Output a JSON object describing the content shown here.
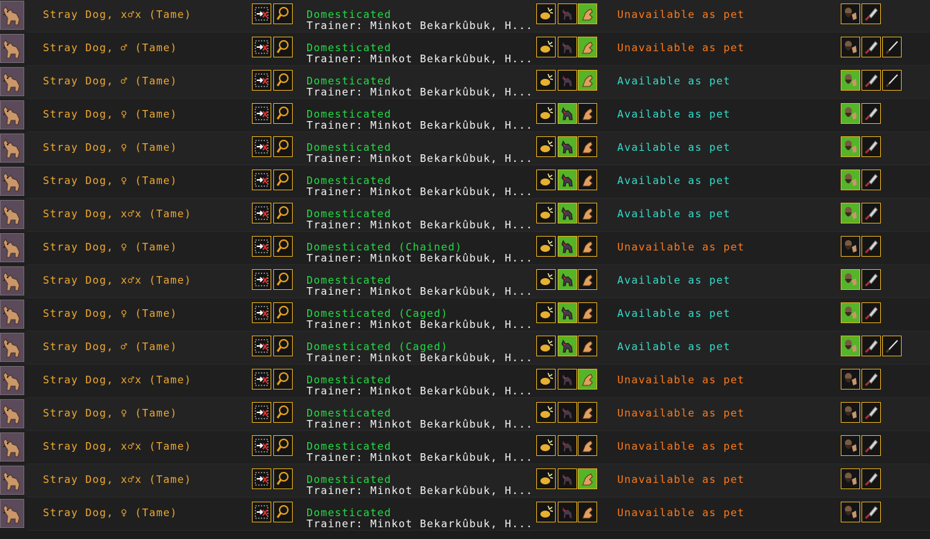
{
  "colors": {
    "name": "#f0a830",
    "domesticated": "#22dd44",
    "trainer": "#f4f4f4",
    "unavailable": "#ff7a1a",
    "available": "#33ddcc",
    "button_border": "#e8b020",
    "button_active": "#55b428"
  },
  "icons": {
    "portrait": "stray-dog-portrait",
    "assign": "assign-arrow-icon",
    "inspect": "magnifier-icon",
    "train_1": "war-training-icon",
    "train_2": "hunting-training-icon",
    "train_3": "pet-training-icon",
    "adopt": "dwarf-adopt-icon",
    "butcher": "butcher-cleaver-icon",
    "geld": "geld-knife-icon"
  },
  "rows": [
    {
      "name": "Stray Dog, x♂x (Tame)",
      "status": "Domesticated",
      "trainer": "Trainer: Minkot Bekarkûbuk, H...",
      "pet": "Unavailable as pet",
      "available": false,
      "training": [
        false,
        false,
        true
      ],
      "adopt_on": false,
      "geld": false
    },
    {
      "name": "Stray Dog, ♂ (Tame)",
      "status": "Domesticated",
      "trainer": "Trainer: Minkot Bekarkûbuk, H...",
      "pet": "Unavailable as pet",
      "available": false,
      "training": [
        false,
        false,
        true
      ],
      "adopt_on": false,
      "geld": true
    },
    {
      "name": "Stray Dog, ♂ (Tame)",
      "status": "Domesticated",
      "trainer": "Trainer: Minkot Bekarkûbuk, H...",
      "pet": "Available as pet",
      "available": true,
      "training": [
        false,
        false,
        true
      ],
      "adopt_on": true,
      "geld": true
    },
    {
      "name": "Stray Dog, ♀ (Tame)",
      "status": "Domesticated",
      "trainer": "Trainer: Minkot Bekarkûbuk, H...",
      "pet": "Available as pet",
      "available": true,
      "training": [
        false,
        true,
        false
      ],
      "adopt_on": true,
      "geld": false
    },
    {
      "name": "Stray Dog, ♀ (Tame)",
      "status": "Domesticated",
      "trainer": "Trainer: Minkot Bekarkûbuk, H...",
      "pet": "Available as pet",
      "available": true,
      "training": [
        false,
        true,
        false
      ],
      "adopt_on": true,
      "geld": false
    },
    {
      "name": "Stray Dog, ♀ (Tame)",
      "status": "Domesticated",
      "trainer": "Trainer: Minkot Bekarkûbuk, H...",
      "pet": "Available as pet",
      "available": true,
      "training": [
        false,
        true,
        false
      ],
      "adopt_on": true,
      "geld": false
    },
    {
      "name": "Stray Dog, x♂x (Tame)",
      "status": "Domesticated",
      "trainer": "Trainer: Minkot Bekarkûbuk, H...",
      "pet": "Available as pet",
      "available": true,
      "training": [
        false,
        true,
        false
      ],
      "adopt_on": true,
      "geld": false
    },
    {
      "name": "Stray Dog, ♀ (Tame)",
      "status": "Domesticated (Chained)",
      "trainer": "Trainer: Minkot Bekarkûbuk, H...",
      "pet": "Unavailable as pet",
      "available": false,
      "training": [
        false,
        true,
        false
      ],
      "adopt_on": false,
      "geld": false
    },
    {
      "name": "Stray Dog, x♂x (Tame)",
      "status": "Domesticated",
      "trainer": "Trainer: Minkot Bekarkûbuk, H...",
      "pet": "Available as pet",
      "available": true,
      "training": [
        false,
        true,
        false
      ],
      "adopt_on": true,
      "geld": false
    },
    {
      "name": "Stray Dog, ♀ (Tame)",
      "status": "Domesticated (Caged)",
      "trainer": "Trainer: Minkot Bekarkûbuk, H...",
      "pet": "Available as pet",
      "available": true,
      "training": [
        false,
        true,
        false
      ],
      "adopt_on": true,
      "geld": false
    },
    {
      "name": "Stray Dog, ♂ (Tame)",
      "status": "Domesticated (Caged)",
      "trainer": "Trainer: Minkot Bekarkûbuk, H...",
      "pet": "Available as pet",
      "available": true,
      "training": [
        false,
        true,
        false
      ],
      "adopt_on": true,
      "geld": true
    },
    {
      "name": "Stray Dog, x♂x (Tame)",
      "status": "Domesticated",
      "trainer": "Trainer: Minkot Bekarkûbuk, H...",
      "pet": "Unavailable as pet",
      "available": false,
      "training": [
        false,
        false,
        true
      ],
      "adopt_on": false,
      "geld": false
    },
    {
      "name": "Stray Dog, ♀ (Tame)",
      "status": "Domesticated",
      "trainer": "Trainer: Minkot Bekarkûbuk, H...",
      "pet": "Unavailable as pet",
      "available": false,
      "training": [
        false,
        false,
        false
      ],
      "adopt_on": false,
      "geld": false
    },
    {
      "name": "Stray Dog, x♂x (Tame)",
      "status": "Domesticated",
      "trainer": "Trainer: Minkot Bekarkûbuk, H...",
      "pet": "Unavailable as pet",
      "available": false,
      "training": [
        false,
        false,
        false
      ],
      "adopt_on": false,
      "geld": false
    },
    {
      "name": "Stray Dog, x♂x (Tame)",
      "status": "Domesticated",
      "trainer": "Trainer: Minkot Bekarkûbuk, H...",
      "pet": "Unavailable as pet",
      "available": false,
      "training": [
        false,
        false,
        true
      ],
      "adopt_on": false,
      "geld": false
    },
    {
      "name": "Stray Dog, ♀ (Tame)",
      "status": "Domesticated",
      "trainer": "Trainer: Minkot Bekarkûbuk, H...",
      "pet": "Unavailable as pet",
      "available": false,
      "training": [
        false,
        false,
        false
      ],
      "adopt_on": false,
      "geld": false
    }
  ]
}
